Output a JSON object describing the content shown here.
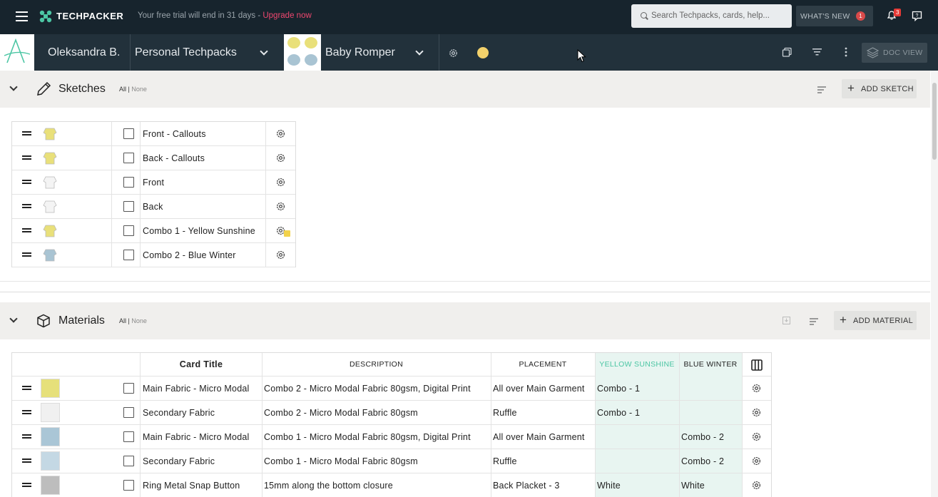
{
  "topbar": {
    "brand": "TECHPACKER",
    "trial_text": "Your free trial will end in 31 days - ",
    "upgrade_link": "Upgrade now",
    "search_placeholder": "Search Techpacks, cards, help...",
    "whats_new": "WHAT'S NEW",
    "whats_new_count": "1",
    "notification_count": "3"
  },
  "subbar": {
    "user_name": "Oleksandra B.",
    "workspace": "Personal Techpacks",
    "product": "Baby Romper",
    "doc_view": "DOC VIEW"
  },
  "sketches": {
    "title": "Sketches",
    "filter_all": "All |",
    "filter_none": "None",
    "add_button": "ADD SKETCH",
    "items": [
      {
        "name": "Front - Callouts",
        "thumb_color": "#e9e07a"
      },
      {
        "name": "Back - Callouts",
        "thumb_color": "#e9e07a"
      },
      {
        "name": "Front",
        "thumb_color": "#f4f4f4"
      },
      {
        "name": "Back",
        "thumb_color": "#f4f4f4"
      },
      {
        "name": "Combo 1 - Yellow Sunshine",
        "thumb_color": "#e9e07a"
      },
      {
        "name": "Combo 2 - Blue Winter",
        "thumb_color": "#a9c4d3"
      }
    ]
  },
  "materials": {
    "title": "Materials",
    "filter_all": "All |",
    "filter_none": "None",
    "add_button": "ADD MATERIAL",
    "columns": {
      "card_title": "Card Title",
      "description": "DESCRIPTION",
      "placement": "PLACEMENT",
      "yellow": "YELLOW SUNSHINE",
      "blue": "BLUE WINTER"
    },
    "rows": [
      {
        "title": "Main Fabric - Micro Modal",
        "description": "Combo 2 - Micro Modal Fabric 80gsm, Digital Print",
        "placement": "All over Main Garment",
        "yellow": "Combo - 1",
        "blue": "",
        "thumb_color": "#e6e07a"
      },
      {
        "title": "Secondary Fabric",
        "description": "Combo 2 - Micro Modal Fabric 80gsm",
        "placement": "Ruffle",
        "yellow": "Combo - 1",
        "blue": "",
        "thumb_color": "#f0f0f0"
      },
      {
        "title": "Main Fabric - Micro Modal",
        "description": "Combo 1 - Micro Modal Fabric 80gsm, Digital Print",
        "placement": "All over Main Garment",
        "yellow": "",
        "blue": "Combo - 2",
        "thumb_color": "#aac6d6"
      },
      {
        "title": "Secondary Fabric",
        "description": "Combo 1 - Micro Modal Fabric 80gsm",
        "placement": "Ruffle",
        "yellow": "",
        "blue": "Combo - 2",
        "thumb_color": "#c4d8e4"
      },
      {
        "title": "Ring Metal Snap Button",
        "description": "15mm along the bottom closure",
        "placement": "Back Placket - 3",
        "yellow": "White",
        "blue": "White",
        "thumb_color": "#bdbdbd"
      }
    ]
  },
  "colors": {
    "topbar_bg": "#17242d",
    "subbar_bg": "#22313b",
    "accent_teal": "#4cc6a4",
    "upgrade_pink": "#ef476f",
    "combo_shade": "#e8f5f1"
  }
}
